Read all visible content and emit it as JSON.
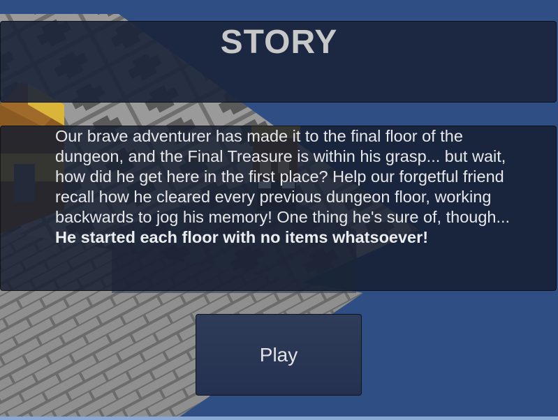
{
  "screen": {
    "title": "STORY",
    "story_intro": "Our brave adventurer has made it to the final floor of the dungeon, and the Final Treasure is within his grasp... but wait, how did he get here in the first place? Help our forgetful friend recall how he cleared every previous dungeon floor, working backwards to jog his memory! One thing he's sure of, though... ",
    "story_emphasis": "He started each floor with no items whatsoever!",
    "play_label": "Play"
  },
  "colors": {
    "background": "#2f4f84",
    "panel": "#1b243a",
    "title_text": "#c8c8c8",
    "body_text": "#e8e8ea",
    "chest_gold": "#d9b53a",
    "chest_wood": "#8a5a22",
    "floor_stone": "#8c8c8c"
  }
}
